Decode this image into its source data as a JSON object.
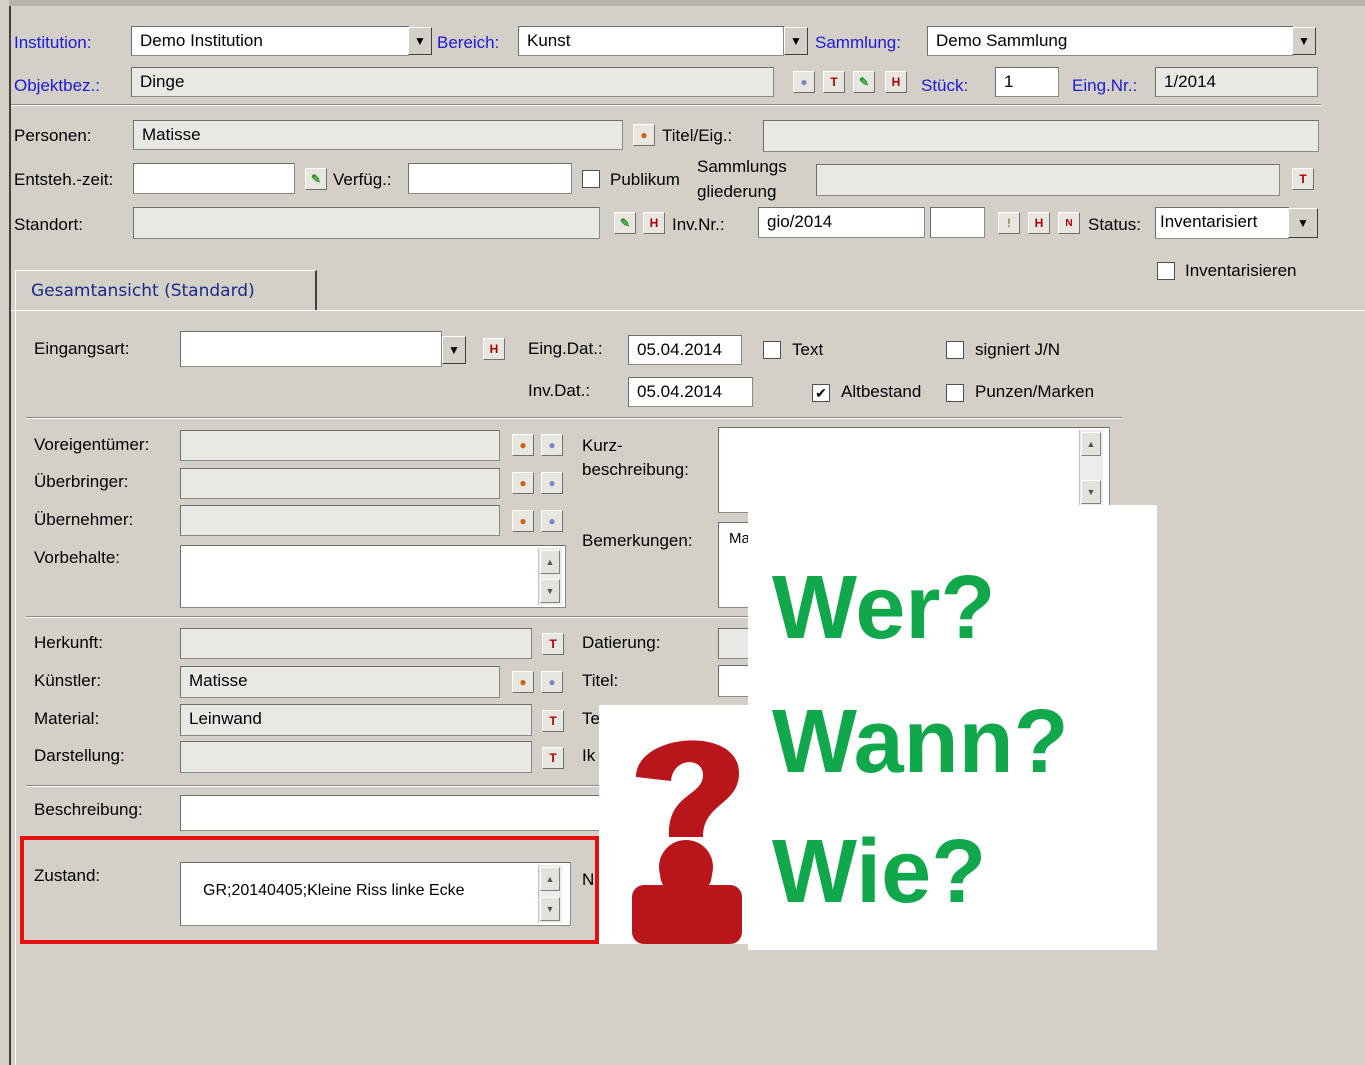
{
  "header": {
    "institution_label": "Institution:",
    "institution_value": "Demo Institution",
    "bereich_label": "Bereich:",
    "bereich_value": "Kunst",
    "sammlung_label": "Sammlung:",
    "sammlung_value": "Demo Sammlung",
    "objektbez_label": "Objektbez.:",
    "objektbez_value": "Dinge",
    "stueck_label": "Stück:",
    "stueck_value": "1",
    "eingnr_label": "Eing.Nr.:",
    "eingnr_value": "1/2014"
  },
  "persons": {
    "personen_label": "Personen:",
    "personen_value": "Matisse",
    "titel_label": "Titel/Eig.:",
    "titel_value": "",
    "entsteh_label": "Entsteh.-zeit:",
    "verfueg_label": "Verfüg.:",
    "publikum_label": "Publikum",
    "sammlungs_label_1": "Sammlungs",
    "sammlungs_label_2": "gliederung",
    "standort_label": "Standort:",
    "invnr_label": "Inv.Nr.:",
    "invnr_value": "gio/2014",
    "status_label": "Status:",
    "status_value": "Inventarisiert",
    "inventarisieren_label": "Inventarisieren"
  },
  "tab": {
    "label": "Gesamtansicht (Standard)"
  },
  "form": {
    "eingangsart_label": "Eingangsart:",
    "eingdat_label": "Eing.Dat.:",
    "eingdat_value": "05.04.2014",
    "invdat_label": "Inv.Dat.:",
    "invdat_value": "05.04.2014",
    "text_label": "Text",
    "signiert_label": "signiert J/N",
    "altbestand_label": "Altbestand",
    "punzen_label": "Punzen/Marken",
    "voreigentuemer_label": "Voreigentümer:",
    "ueberbringer_label": "Überbringer:",
    "uebernehmer_label": "Übernehmer:",
    "vorbehalte_label": "Vorbehalte:",
    "kurz_label_1": "Kurz-",
    "kurz_label_2": "beschreibung:",
    "bemerkungen_label": "Bemerkungen:",
    "bemerkungen_value": "Ma",
    "herkunft_label": "Herkunft:",
    "datierung_label": "Datierung:",
    "kuenstler_label": "Künstler:",
    "kuenstler_value": "Matisse",
    "titel2_label": "Titel:",
    "material_label": "Material:",
    "material_value": "Leinwand",
    "te_label": "Te",
    "darstellung_label": "Darstellung:",
    "iko_label": "Ik",
    "beschreibung_label": "Beschreibung:",
    "zustand_label": "Zustand:",
    "zustand_value": "GR;20140405;Kleine Riss linke Ecke",
    "n_label": "N"
  },
  "overlay": {
    "q1": "Wer?",
    "q2": "Wann?",
    "q3": "Wie?"
  },
  "colors": {
    "accent_green": "#11a84c",
    "highlight_red": "#e21010",
    "figure_red": "#b8161a"
  }
}
